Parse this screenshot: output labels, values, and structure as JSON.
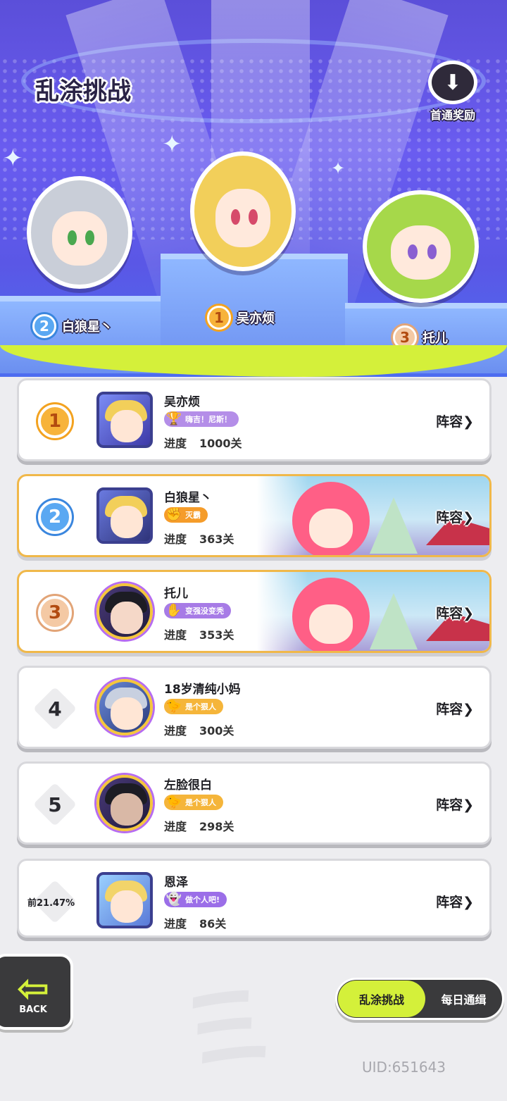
{
  "header": {
    "title": "乱涂挑战",
    "reward_label": "首通奖励"
  },
  "podium": [
    {
      "rank": "2",
      "name": "白狼星丶"
    },
    {
      "rank": "1",
      "name": "吴亦烦"
    },
    {
      "rank": "3",
      "name": "托儿"
    }
  ],
  "progress_label": "进度",
  "lineup_label": "阵容",
  "rows": [
    {
      "rank": "1",
      "name": "吴亦烦",
      "title": "嗨吉！尼斯！",
      "progress": "1000关"
    },
    {
      "rank": "2",
      "name": "白狼星丶",
      "title": "灭霸",
      "progress": "363关"
    },
    {
      "rank": "3",
      "name": "托儿",
      "title": "变强没变秃",
      "progress": "353关"
    },
    {
      "rank": "4",
      "name": "18岁清纯小妈",
      "title": "是个狠人",
      "progress": "300关"
    },
    {
      "rank": "5",
      "name": "左脸很白",
      "title": "是个狠人",
      "progress": "298关"
    },
    {
      "rank": "前21.47%",
      "name": "恩泽",
      "title": "做个人吧!",
      "progress": "86关"
    }
  ],
  "bottom": {
    "back_label": "BACK",
    "tab_active": "乱涂挑战",
    "tab_inactive": "每日通缉",
    "uid": "UID:651643"
  },
  "colors": {
    "accent_lime": "#d4f03a",
    "header_purple": "#5b4fd9",
    "highlight_border": "#f0b84a"
  }
}
